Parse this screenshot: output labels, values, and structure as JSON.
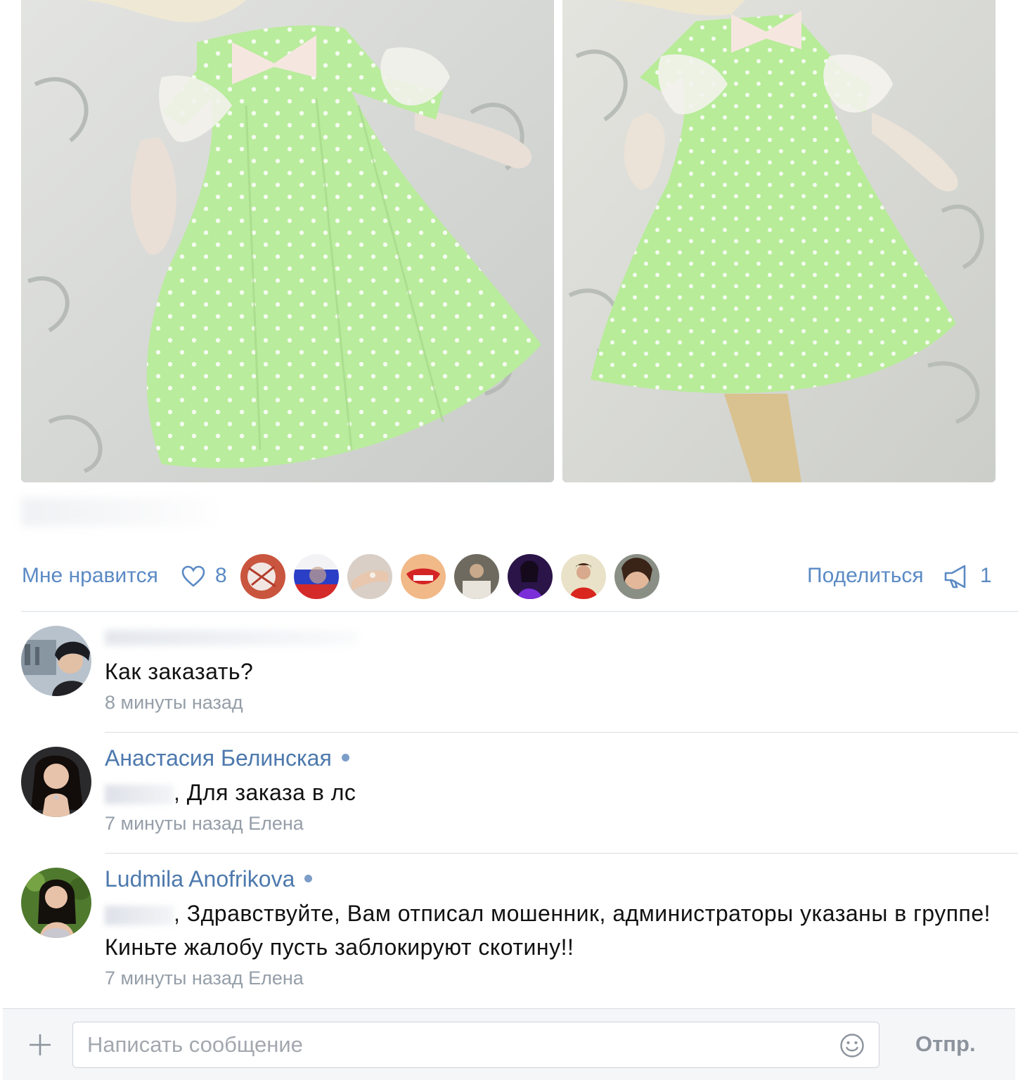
{
  "post": {
    "photos": [
      {
        "name": "photo-doll-front"
      },
      {
        "name": "photo-doll-closeup"
      }
    ]
  },
  "actions": {
    "like_label": "Мне нравится",
    "like_count": "8",
    "share_label": "Поделиться",
    "share_count": "1",
    "icons": {
      "like": "heart-icon",
      "share": "megaphone-icon"
    }
  },
  "comments": [
    {
      "author": "",
      "text": "Как заказать?",
      "time": "8 минуты назад"
    },
    {
      "author": "Анастасия Белинская",
      "text": ", Для заказа в лс",
      "time": "7 минуты назад Елена"
    },
    {
      "author": "Ludmila Anofrikova",
      "text": ", Здравствуйте, Вам отписал мошенник, администраторы указаны в группе! Киньте жалобу пусть заблокируют скотину!!",
      "time": "7 минуты назад Елена"
    }
  ],
  "composer": {
    "placeholder": "Написать сообщение",
    "send_label": "Отпр.",
    "icons": {
      "attach": "plus-icon",
      "emoji": "smile-icon"
    }
  },
  "colors": {
    "link": "#5b8ac4",
    "author": "#4d79ad",
    "muted": "#959ea8",
    "dress_green": "#b8ec9a"
  }
}
